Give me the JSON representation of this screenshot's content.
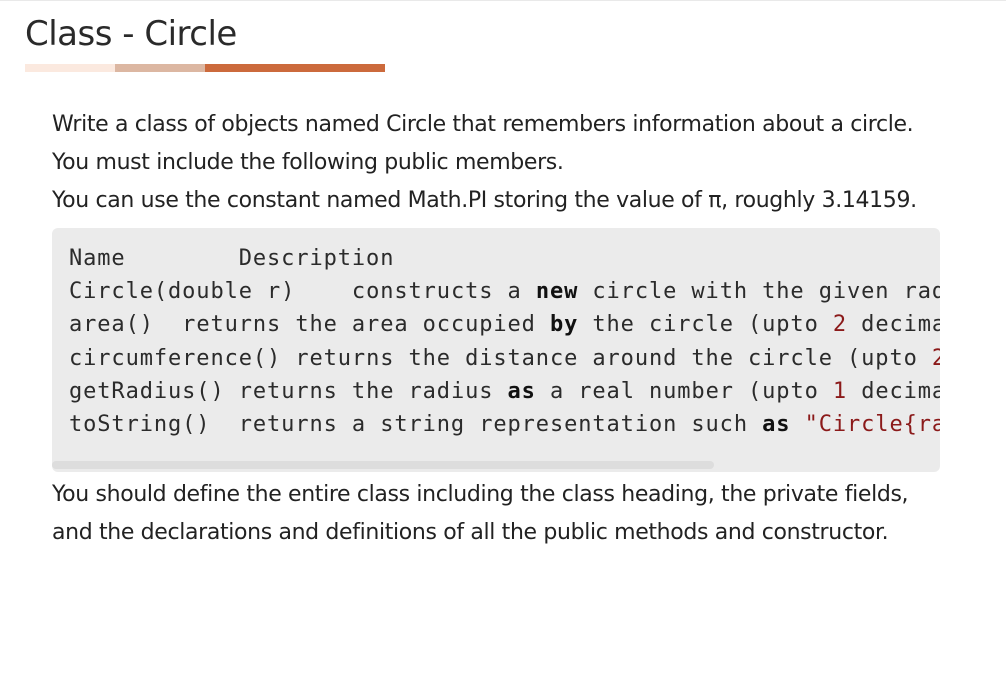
{
  "colors": {
    "underline_light": "#fbe9df",
    "underline_mid": "#dcb7a2",
    "underline_accent": "#cc6a3c"
  },
  "page": {
    "title": "Class - Circle"
  },
  "intro": {
    "line1": "Write a class of objects named Circle that remembers information about a circle. You must include the following public members.",
    "line2": "You can use the constant named Math.PI storing the value of π, roughly 3.14159."
  },
  "code": {
    "header": "Name        Description",
    "rows": [
      {
        "name": "Circle(double r)",
        "gap": "    ",
        "parts": [
          "constructs a ",
          "new",
          " circle with the given rad"
        ]
      },
      {
        "name": "area()",
        "gap": "  ",
        "parts": [
          "returns the area occupied ",
          "by",
          " the circle (upto ",
          "2",
          " decima"
        ]
      },
      {
        "name": "circumference()",
        "gap": " ",
        "parts": [
          "returns the distance around the circle (upto ",
          "2"
        ]
      },
      {
        "name": "getRadius()",
        "gap": " ",
        "parts": [
          "returns the radius ",
          "as",
          " a real number (upto ",
          "1",
          " decima"
        ]
      },
      {
        "name": "toString()",
        "gap": "  ",
        "parts": [
          "returns a string representation such ",
          "as",
          " ",
          "\"Circle{ra"
        ]
      }
    ]
  },
  "outro": {
    "text": "You should define the entire class including the class heading, the private fields, and the declarations and definitions of all the public methods and constructor."
  }
}
